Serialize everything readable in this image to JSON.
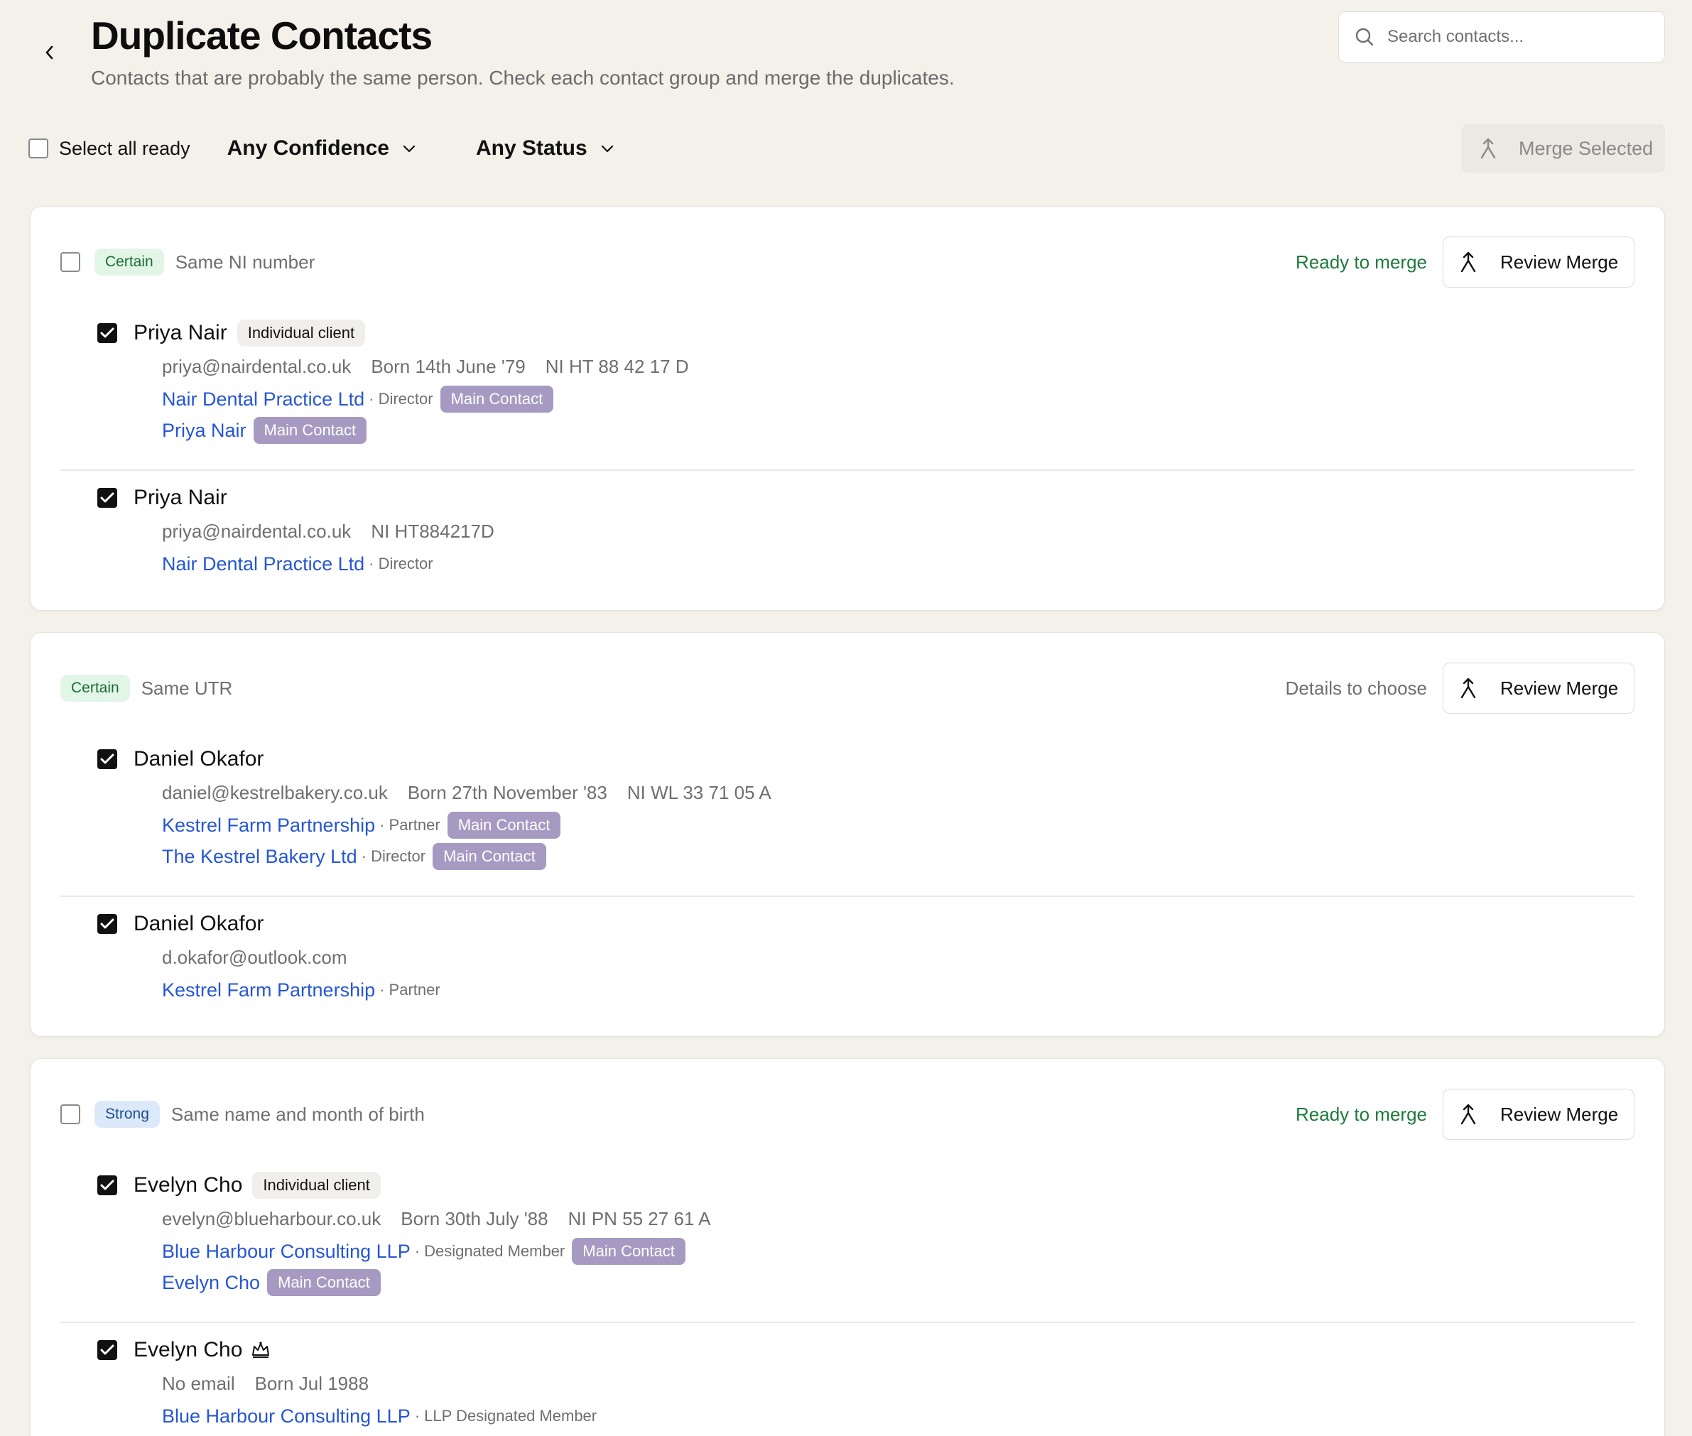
{
  "header": {
    "title": "Duplicate Contacts",
    "subtitle": "Contacts that are probably the same person. Check each contact group and merge the duplicates."
  },
  "search": {
    "placeholder": "Search contacts...",
    "value": ""
  },
  "toolbar": {
    "select_all_label": "Select all ready",
    "confidence_filter": "Any Confidence",
    "status_filter": "Any Status",
    "merge_selected_label": "Merge Selected"
  },
  "groups": [
    {
      "confidence": "Certain",
      "reason": "Same NI number",
      "status": "Ready to merge",
      "review_label": "Review Merge",
      "contacts": [
        {
          "name": "Priya Nair",
          "type": "Individual client",
          "meta": [
            "priya@nairdental.co.uk",
            "Born 14th June '79",
            "NI HT 88 42 17 D"
          ],
          "links": [
            {
              "label": "Nair Dental Practice Ltd",
              "role": "· Director",
              "tag": "Main Contact"
            },
            {
              "label": "Priya Nair",
              "role": "",
              "tag": "Main Contact"
            }
          ]
        },
        {
          "name": "Priya Nair",
          "meta": [
            "priya@nairdental.co.uk",
            "NI HT884217D"
          ],
          "links": [
            {
              "label": "Nair Dental Practice Ltd",
              "role": "· Director"
            }
          ]
        }
      ]
    },
    {
      "confidence": "Certain",
      "reason": "Same UTR",
      "status": "Details to choose",
      "review_label": "Review Merge",
      "contacts": [
        {
          "name": "Daniel Okafor",
          "meta": [
            "daniel@kestrelbakery.co.uk",
            "Born 27th November '83",
            "NI WL 33 71 05 A"
          ],
          "links": [
            {
              "label": "Kestrel Farm Partnership",
              "role": "· Partner",
              "tag": "Main Contact"
            },
            {
              "label": "The Kestrel Bakery Ltd",
              "role": "· Director",
              "tag": "Main Contact"
            }
          ]
        },
        {
          "name": "Daniel Okafor",
          "meta": [
            "d.okafor@outlook.com"
          ],
          "links": [
            {
              "label": "Kestrel Farm Partnership",
              "role": "· Partner"
            }
          ]
        }
      ]
    },
    {
      "confidence": "Strong",
      "reason": "Same name and month of birth",
      "status": "Ready to merge",
      "review_label": "Review Merge",
      "contacts": [
        {
          "name": "Evelyn Cho",
          "type": "Individual client",
          "meta": [
            "evelyn@blueharbour.co.uk",
            "Born 30th July '88",
            "NI PN 55 27 61 A"
          ],
          "links": [
            {
              "label": "Blue Harbour Consulting LLP",
              "role": "· Designated Member",
              "tag": "Main Contact"
            },
            {
              "label": "Evelyn Cho",
              "role": "",
              "tag": "Main Contact"
            }
          ]
        },
        {
          "name": "Evelyn Cho",
          "icon": "crown-icon",
          "meta": [
            "No email",
            "Born Jul 1988"
          ],
          "links": [
            {
              "label": "Blue Harbour Consulting LLP",
              "role": "· LLP Designated Member"
            }
          ]
        }
      ]
    }
  ]
}
